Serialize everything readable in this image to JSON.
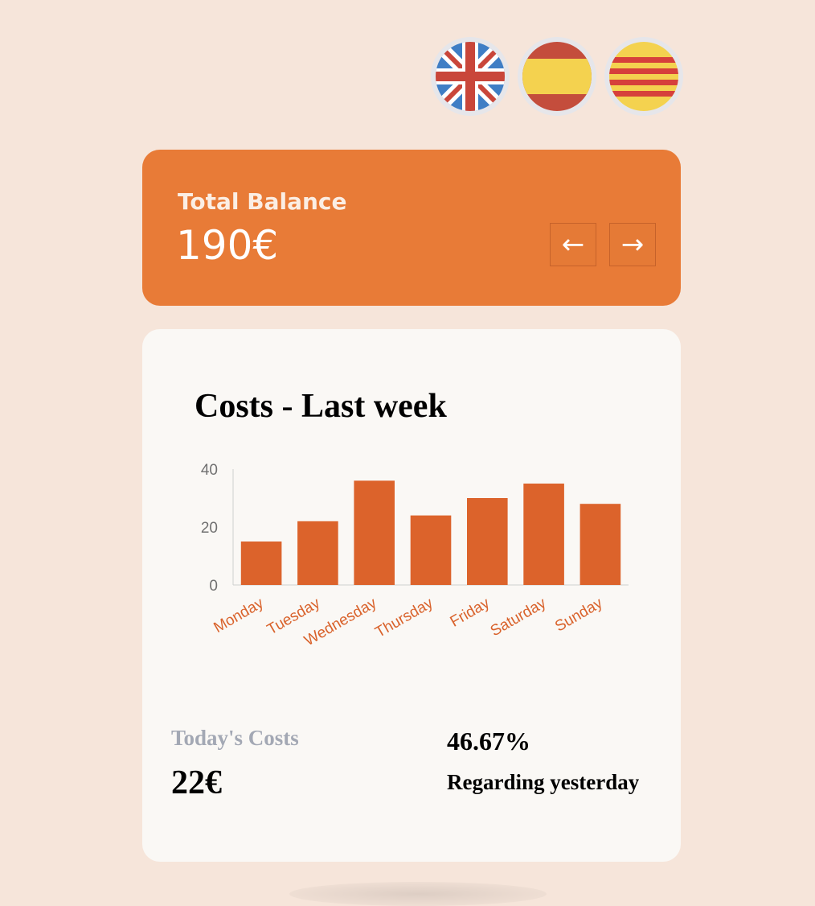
{
  "languages": [
    {
      "name": "English",
      "icon": "uk-flag-icon"
    },
    {
      "name": "Spanish",
      "icon": "spain-flag-icon"
    },
    {
      "name": "Catalan",
      "icon": "catalonia-flag-icon"
    }
  ],
  "balance": {
    "label": "Total Balance",
    "value": "190€",
    "prev_label": "←",
    "next_label": "→"
  },
  "costs": {
    "title": "Costs - Last week",
    "today_label": "Today's Costs",
    "today_value": "22€",
    "change_value": "46.67%",
    "change_label": "Regarding yesterday"
  },
  "colors": {
    "background": "#f6e5da",
    "accent": "#e87b37",
    "bar": "#dc632b",
    "card": "#faf8f5"
  },
  "chart_data": {
    "type": "bar",
    "categories": [
      "Monday",
      "Tuesday",
      "Wednesday",
      "Thursday",
      "Friday",
      "Saturday",
      "Sunday"
    ],
    "values": [
      15,
      22,
      36,
      24,
      30,
      35,
      28
    ],
    "title": "Costs - Last week",
    "ylim": [
      0,
      40
    ],
    "yticks": [
      0,
      20,
      40
    ],
    "grid": false,
    "legend": "none"
  }
}
